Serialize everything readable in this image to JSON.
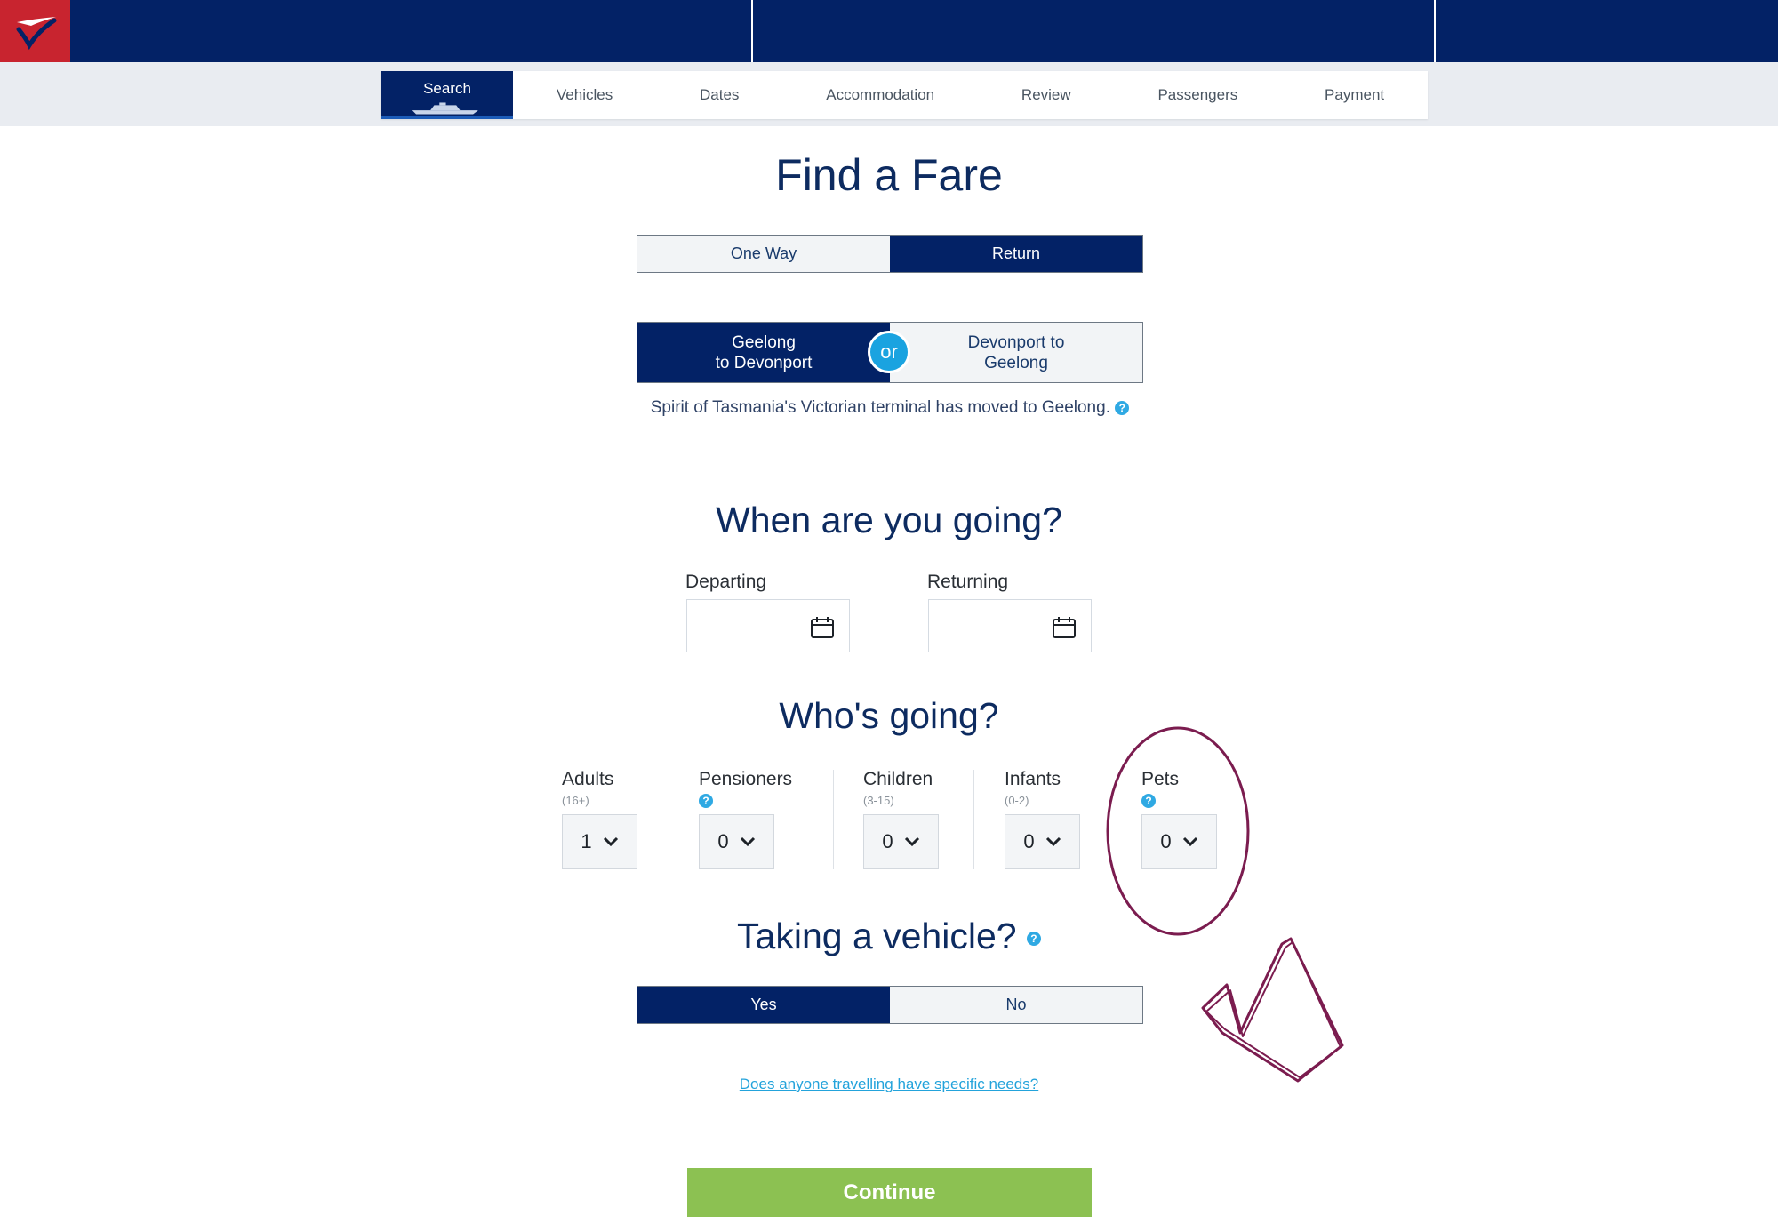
{
  "steps": [
    "Search",
    "Vehicles",
    "Dates",
    "Accommodation",
    "Review",
    "Passengers",
    "Payment"
  ],
  "active_step": "Search",
  "title": "Find a Fare",
  "trip_type": {
    "one_way": "One Way",
    "return": "Return",
    "selected": "Return"
  },
  "route": {
    "option_a_line1": "Geelong",
    "option_a_line2": "to Devonport",
    "or": "or",
    "option_b_line1": "Devonport to",
    "option_b_line2": "Geelong",
    "selected": "Geelong to Devonport"
  },
  "terminal_note": "Spirit of Tasmania's Victorian terminal has moved to Geelong.",
  "help_glyph": "?",
  "when": {
    "heading": "When are you going?",
    "departing_label": "Departing",
    "departing_value": "",
    "returning_label": "Returning",
    "returning_value": ""
  },
  "who": {
    "heading": "Who's going?",
    "adults": {
      "label": "Adults",
      "sub": "(16+)",
      "value": "1"
    },
    "pensioners": {
      "label": "Pensioners",
      "value": "0"
    },
    "children": {
      "label": "Children",
      "sub": "(3-15)",
      "value": "0"
    },
    "infants": {
      "label": "Infants",
      "sub": "(0-2)",
      "value": "0"
    },
    "pets": {
      "label": "Pets",
      "value": "0"
    }
  },
  "vehicle": {
    "heading": "Taking a vehicle?",
    "yes": "Yes",
    "no": "No",
    "selected": "Yes"
  },
  "specific_needs_link": "Does anyone travelling have specific needs?",
  "continue_label": "Continue",
  "colors": {
    "navy": "#032266",
    "accent_blue": "#1aa3e0",
    "continue_green": "#8cc152",
    "logo_red": "#c8242f",
    "annotation": "#7b1c4f"
  },
  "icons": [
    "logo-icon",
    "ship-icon",
    "calendar-icon",
    "help-icon",
    "chevron-down-icon"
  ]
}
